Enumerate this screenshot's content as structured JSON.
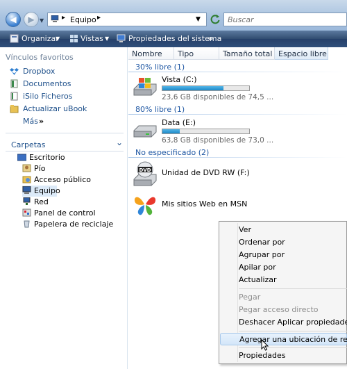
{
  "address": {
    "crumb_sep1": "▸",
    "crumb": "Equipo",
    "crumb_sep2": "▸",
    "dropdown_icon": "chevron-down-icon",
    "search_placeholder": "Buscar"
  },
  "toolbar": {
    "organize": "Organizar",
    "views": "Vistas",
    "system_props": "Propiedades del sistema",
    "more": "»"
  },
  "nav": {
    "favorites_header": "Vínculos favoritos",
    "favorites": [
      {
        "label": "Dropbox",
        "icon": "dropbox-icon"
      },
      {
        "label": "Documentos",
        "icon": "documents-icon"
      },
      {
        "label": "iSilo Ficheros",
        "icon": "isilo-icon"
      },
      {
        "label": "Actualizar uBook",
        "icon": "folder-icon"
      }
    ],
    "more_label": "Más",
    "more_arrow": "»",
    "folders_header": "Carpetas",
    "folders_chevron": "⌄",
    "tree": [
      {
        "label": "Escritorio",
        "icon": "desktop-icon"
      },
      {
        "label": "Pío",
        "icon": "user-folder-icon"
      },
      {
        "label": "Acceso público",
        "icon": "public-folder-icon"
      },
      {
        "label": "Equipo",
        "icon": "computer-icon"
      },
      {
        "label": "Red",
        "icon": "network-icon"
      },
      {
        "label": "Panel de control",
        "icon": "control-panel-icon"
      },
      {
        "label": "Papelera de reciclaje",
        "icon": "recycle-bin-icon"
      }
    ]
  },
  "columns": [
    "Nombre",
    "Tipo",
    "Tamaño total",
    "Espacio libre"
  ],
  "groups": {
    "g1": "30% libre (1)",
    "g2": "80% libre (1)",
    "g3": "No especificado (2)"
  },
  "drives": {
    "c": {
      "name": "Vista (C:)",
      "free": "23,6 GB disponibles de 74,5 ...",
      "used_fraction": 0.7
    },
    "e": {
      "name": "Data (E:)",
      "free": "63,8 GB disponibles de 73,0 ...",
      "used_fraction": 0.2
    }
  },
  "items": {
    "dvd": "Unidad de DVD RW (F:)",
    "dvd_badge": "DVD",
    "msn": "Mis sitios Web en MSN"
  },
  "context_menu": {
    "items": [
      "Ver",
      "Ordenar por",
      "Agrupar por",
      "Apilar por",
      "Actualizar",
      "Pegar",
      "Pegar acceso directo",
      "Deshacer Aplicar propiedades",
      "Agregar una ubicación de red",
      "Propiedades"
    ]
  },
  "colors": {
    "accent": "#1f57a3",
    "toolbar": "#2f4f7a",
    "selection": "#dceaf8"
  }
}
